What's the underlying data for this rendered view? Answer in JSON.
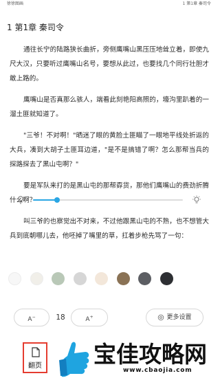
{
  "status_bar": {
    "left_text": "徐徐图画",
    "right_text": "1 第1章 秦司令"
  },
  "chapter": {
    "title": "1 第1章 秦司令"
  },
  "paragraphs": [
    "通往长宁的陆路狭长曲折，旁侧鹰嘴山黑压压地耸立着，即使九尺大汉，只要听过鹰嘴山名号，要想从此过，也要找几个同行壮胆才敢上路的。",
    "鹰嘴山是否真那么骇人，端看此刻艳阳高照的，壕沟里趴着的一溜土匪就知道了。",
    "\"三爷！不对啊！\"晒迷了眼的黄脸土匪瞄了一眼地平线处折返的大兵，凑到大胡子土匪耳边道，\"是不是搞错了啊？怎么那帮当兵的探路探去了黑山屯啊？\"",
    "要是军队来打的是黑山屯的那帮孬货，那他们鹰嘴山的费劲折腾什么啊？",
    "叫三爷的也察觉出不对来，不过他跟黑山屯的不熟，也不想管大兵到底朝哪儿去，他呸掉了嘴里的草，扛着步枪先骂了一句："
  ],
  "brightness": {
    "level": 0.16
  },
  "theme_colors": [
    "#f7f7f7",
    "#f1efe9",
    "#b9c8b7",
    "#d6d6d6",
    "#f3e7da",
    "#8a7255",
    "#5c5e63",
    "#2d2f33"
  ],
  "controls": {
    "font_decrease_label": "A",
    "font_decrease_sup": "−",
    "font_size": "18",
    "font_increase_label": "A",
    "font_increase_sup": "+",
    "more_settings_label": "更多设置"
  },
  "bottom_bar": {
    "flip_label": "翻页"
  },
  "watermark": {
    "title": "宝佳攻略网",
    "url": "www.cbaojia.com"
  },
  "colors": {
    "accent": "#2aa6e4",
    "highlight_border": "#e53c2f"
  }
}
